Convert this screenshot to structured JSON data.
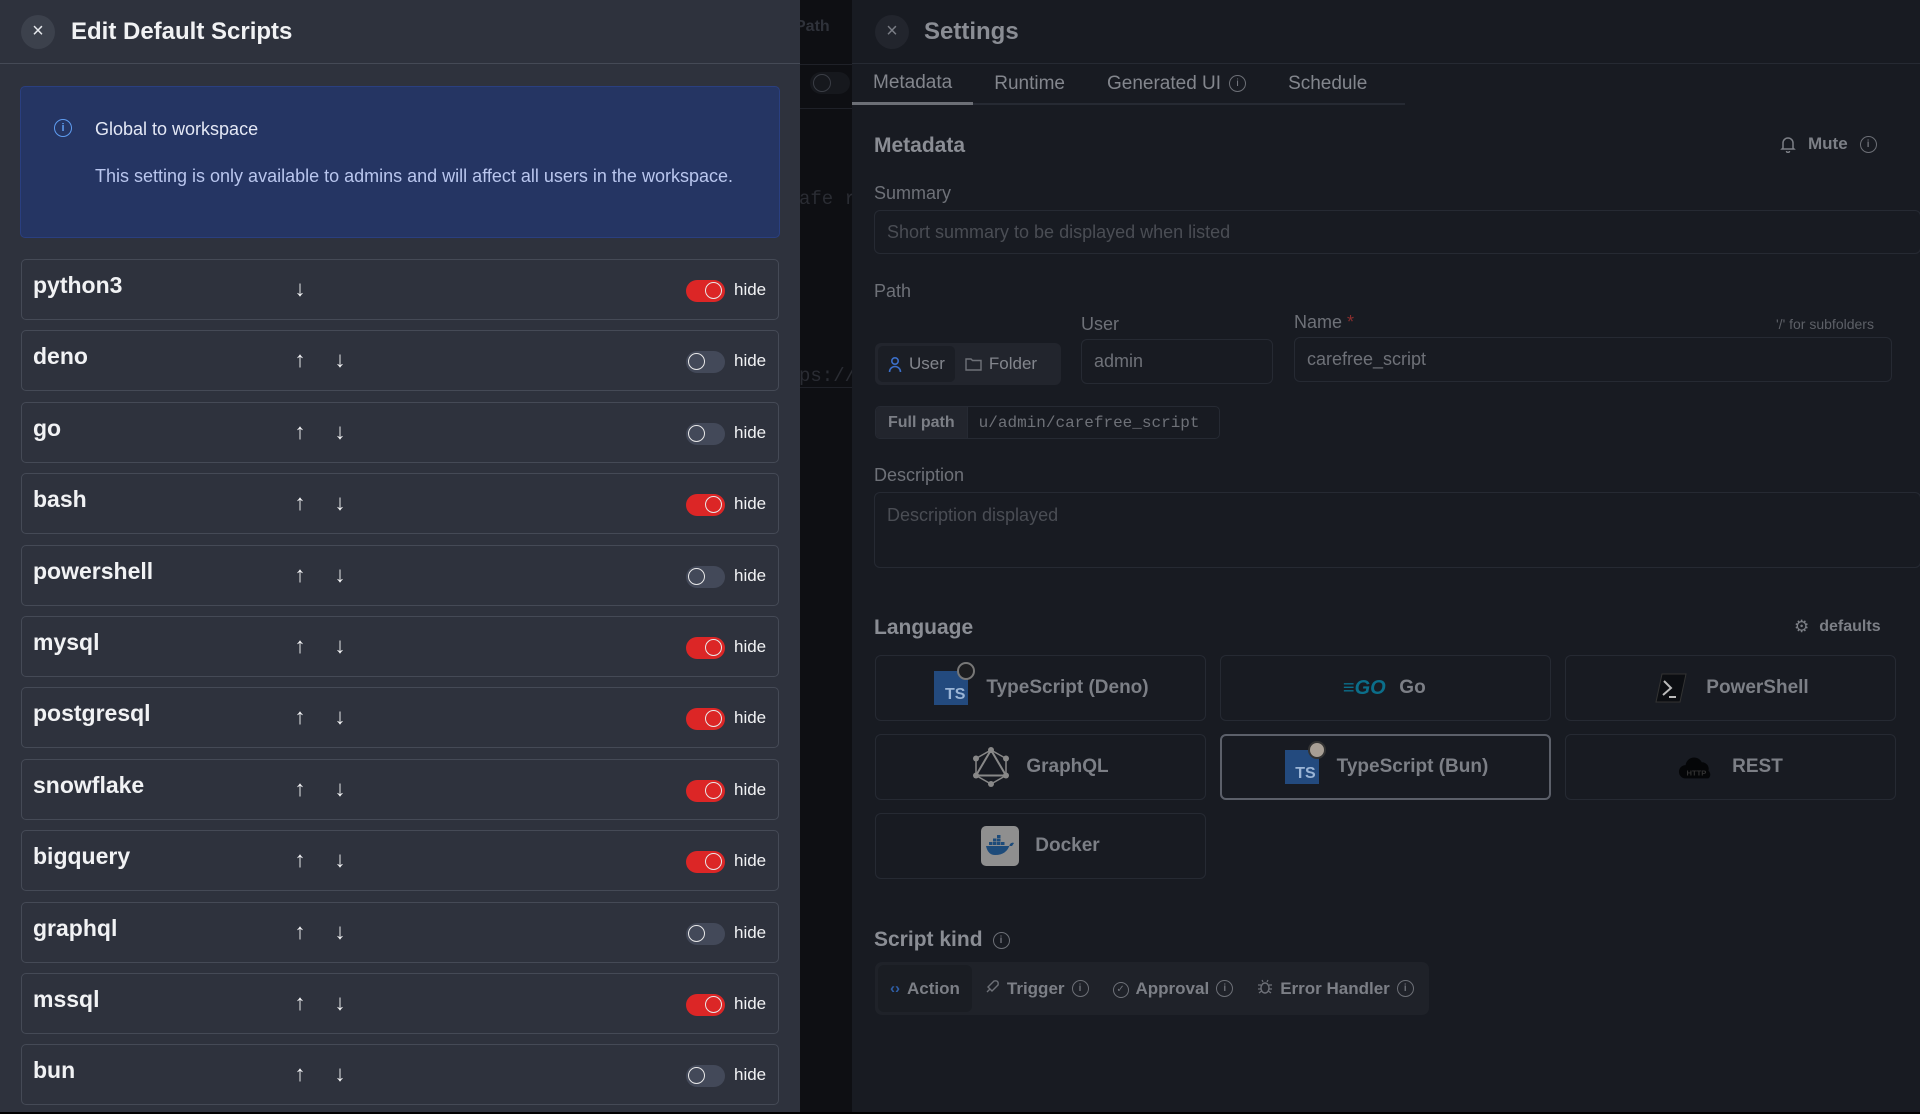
{
  "background_app": {
    "fragments": [
      "Path",
      "afe r",
      "ps://"
    ]
  },
  "left_panel": {
    "title": "Edit Default Scripts",
    "close_icon": "×",
    "banner": {
      "title": "Global to workspace",
      "text": "This setting is only available to admins and will affect all users in the workspace."
    },
    "toggle_label": "hide",
    "rows": [
      {
        "name": "python3",
        "hidden": true,
        "can_up": false,
        "can_down": true
      },
      {
        "name": "deno",
        "hidden": false,
        "can_up": true,
        "can_down": true
      },
      {
        "name": "go",
        "hidden": false,
        "can_up": true,
        "can_down": true
      },
      {
        "name": "bash",
        "hidden": true,
        "can_up": true,
        "can_down": true
      },
      {
        "name": "powershell",
        "hidden": false,
        "can_up": true,
        "can_down": true
      },
      {
        "name": "mysql",
        "hidden": true,
        "can_up": true,
        "can_down": true
      },
      {
        "name": "postgresql",
        "hidden": true,
        "can_up": true,
        "can_down": true
      },
      {
        "name": "snowflake",
        "hidden": true,
        "can_up": true,
        "can_down": true
      },
      {
        "name": "bigquery",
        "hidden": true,
        "can_up": true,
        "can_down": true
      },
      {
        "name": "graphql",
        "hidden": false,
        "can_up": true,
        "can_down": true
      },
      {
        "name": "mssql",
        "hidden": true,
        "can_up": true,
        "can_down": true
      },
      {
        "name": "bun",
        "hidden": false,
        "can_up": true,
        "can_down": true
      }
    ],
    "colors": {
      "toggle_on": "#dc2626",
      "toggle_off": "#434959",
      "banner_bg": "#253563"
    }
  },
  "settings": {
    "title": "Settings",
    "tabs": [
      {
        "label": "Metadata",
        "active": true,
        "info": false
      },
      {
        "label": "Runtime",
        "active": false,
        "info": false
      },
      {
        "label": "Generated UI",
        "active": false,
        "info": true
      },
      {
        "label": "Schedule",
        "active": false,
        "info": false
      }
    ],
    "metadata": {
      "heading": "Metadata",
      "mute_label": "Mute",
      "summary_label": "Summary",
      "summary_placeholder": "Short summary to be displayed when listed",
      "summary_value": "",
      "path_label": "Path",
      "path_kind_options": [
        "User",
        "Folder"
      ],
      "path_kind_selected": "User",
      "user_label": "User",
      "user_value": "admin",
      "name_label": "Name",
      "name_required_mark": "*",
      "name_hint": "'/' for subfolders",
      "name_value": "carefree_script",
      "full_path_label": "Full path",
      "full_path_value": "u/admin/carefree_script",
      "description_label": "Description",
      "description_placeholder": "Description displayed",
      "description_value": ""
    },
    "language": {
      "heading": "Language",
      "defaults_label": "defaults",
      "options": [
        {
          "label": "TypeScript (Deno)",
          "icon": "typescript-deno-icon",
          "selected": false
        },
        {
          "label": "Go",
          "icon": "go-icon",
          "selected": false
        },
        {
          "label": "PowerShell",
          "icon": "powershell-icon",
          "selected": false
        },
        {
          "label": "GraphQL",
          "icon": "graphql-icon",
          "selected": false
        },
        {
          "label": "TypeScript (Bun)",
          "icon": "typescript-bun-icon",
          "selected": true
        },
        {
          "label": "REST",
          "icon": "rest-http-icon",
          "selected": false
        },
        {
          "label": "Docker",
          "icon": "docker-icon",
          "selected": false
        }
      ]
    },
    "script_kind": {
      "heading": "Script kind",
      "options": [
        {
          "label": "Action",
          "icon": "code-icon",
          "active": true,
          "info": false
        },
        {
          "label": "Trigger",
          "icon": "rocket-icon",
          "active": false,
          "info": true
        },
        {
          "label": "Approval",
          "icon": "check-circle-icon",
          "active": false,
          "info": true
        },
        {
          "label": "Error Handler",
          "icon": "bug-icon",
          "active": false,
          "info": true
        }
      ]
    }
  }
}
